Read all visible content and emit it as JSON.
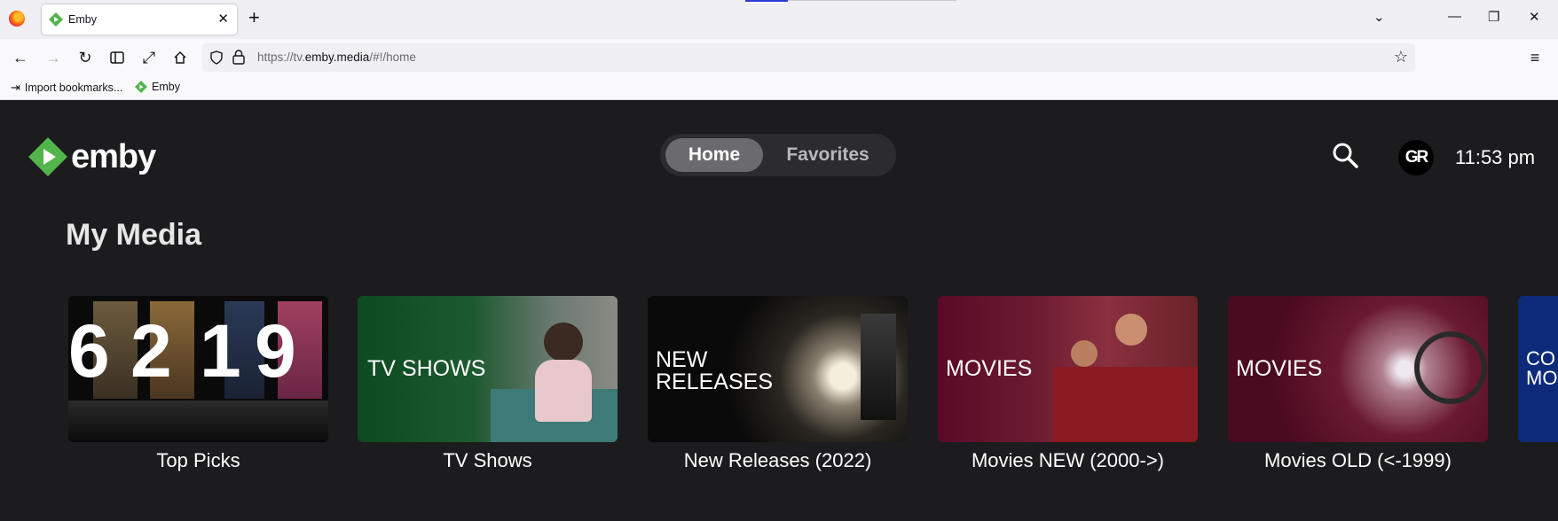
{
  "browser": {
    "tab_title": "Emby",
    "url_prefix": "https://tv.",
    "url_domain": "emby.media",
    "url_path": "/#!/home",
    "bookmarks": [
      {
        "label": "Import bookmarks..."
      },
      {
        "label": "Emby"
      }
    ]
  },
  "app": {
    "logo_text": "emby",
    "brand_color": "#52b54b",
    "nav": {
      "home": "Home",
      "favorites": "Favorites"
    },
    "avatar_initials": "GR",
    "clock": "11:53 pm",
    "section_title": "My Media",
    "libraries": [
      {
        "caption": "Top Picks",
        "overlay": ""
      },
      {
        "caption": "TV Shows",
        "overlay": "TV SHOWS"
      },
      {
        "caption": "New Releases (2022)",
        "overlay": "NEW RELEASES"
      },
      {
        "caption": "Movies NEW (2000->)",
        "overlay": "MOVIES"
      },
      {
        "caption": "Movies OLD (<-1999)",
        "overlay": "MOVIES"
      },
      {
        "caption": "",
        "overlay": "CO MO"
      }
    ]
  }
}
